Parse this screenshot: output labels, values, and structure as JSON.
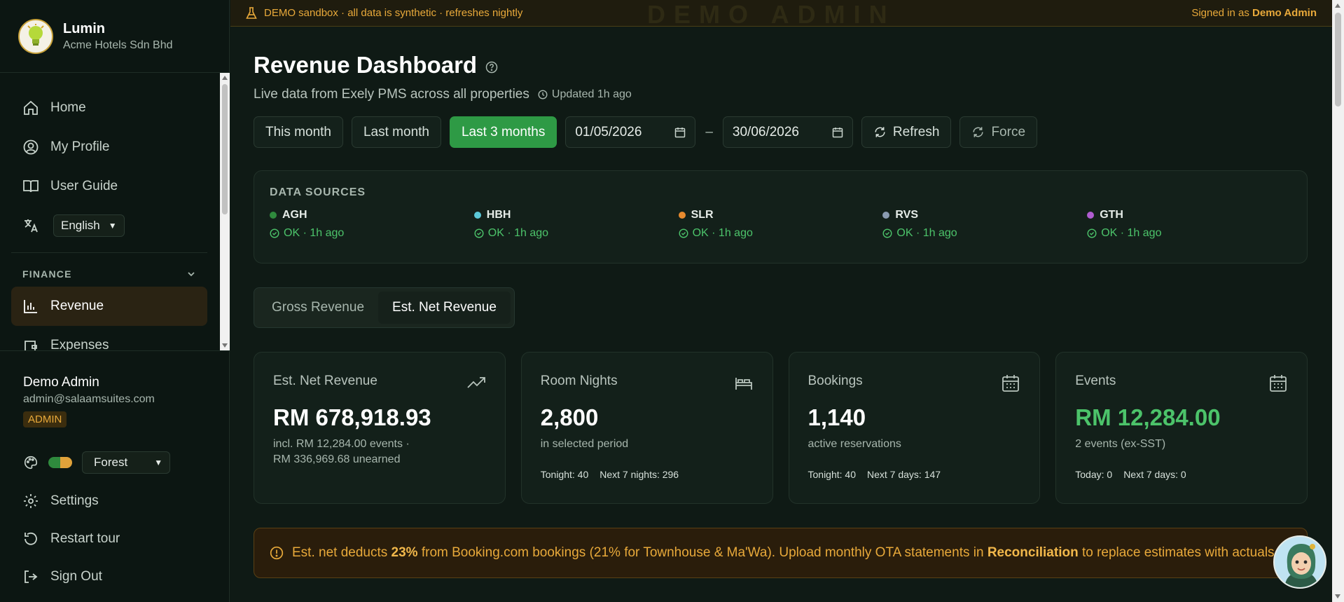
{
  "brand": {
    "name": "Lumin",
    "company": "Acme Hotels Sdn Bhd"
  },
  "sidebar": {
    "items": [
      {
        "label": "Home",
        "icon": "home-icon"
      },
      {
        "label": "My Profile",
        "icon": "user-circle-icon"
      },
      {
        "label": "User Guide",
        "icon": "book-icon"
      }
    ],
    "language": "English",
    "section": "FINANCE",
    "finance_items": [
      {
        "label": "Revenue",
        "icon": "bar-chart-icon"
      },
      {
        "label": "Expenses",
        "icon": "wallet-icon"
      }
    ]
  },
  "user": {
    "name": "Demo Admin",
    "email": "admin@salaamsuites.com",
    "role": "ADMIN"
  },
  "theme": {
    "selected": "Forest"
  },
  "bottom_nav": {
    "settings": "Settings",
    "restart_tour": "Restart tour",
    "sign_out": "Sign Out"
  },
  "banner": {
    "text": "DEMO sandbox · all data is synthetic · refreshes nightly",
    "watermark": "DEMO ADMIN",
    "signed_in_prefix": "Signed in as",
    "signed_in_user": "Demo Admin"
  },
  "page": {
    "title": "Revenue Dashboard",
    "subtitle": "Live data from Exely PMS across all properties",
    "updated": "Updated 1h ago"
  },
  "filters": {
    "this_month": "This month",
    "last_month": "Last month",
    "last_3_months": "Last 3 months",
    "date_from": "01/05/2026",
    "date_sep": "–",
    "date_to": "30/06/2026",
    "refresh": "Refresh",
    "force": "Force"
  },
  "sources": {
    "title": "DATA SOURCES",
    "items": [
      {
        "name": "AGH",
        "status": "OK · 1h ago",
        "color": "#2f8a3d"
      },
      {
        "name": "HBH",
        "status": "OK · 1h ago",
        "color": "#5bc8d8"
      },
      {
        "name": "SLR",
        "status": "OK · 1h ago",
        "color": "#e88a2e"
      },
      {
        "name": "RVS",
        "status": "OK · 1h ago",
        "color": "#8a9bb0"
      },
      {
        "name": "GTH",
        "status": "OK · 1h ago",
        "color": "#b05cd0"
      }
    ]
  },
  "tabs": {
    "gross": "Gross Revenue",
    "net": "Est. Net Revenue"
  },
  "cards": [
    {
      "label": "Est. Net Revenue",
      "value": "RM 678,918.93",
      "sub1": "incl. RM 12,284.00 events ·",
      "sub2": "RM 336,969.68 unearned",
      "meta1": "",
      "meta2": ""
    },
    {
      "label": "Room Nights",
      "value": "2,800",
      "sub1": "in selected period",
      "sub2": "",
      "meta1": "Tonight: 40",
      "meta2": "Next 7 nights: 296"
    },
    {
      "label": "Bookings",
      "value": "1,140",
      "sub1": "active reservations",
      "sub2": "",
      "meta1": "Tonight: 40",
      "meta2": "Next 7 days: 147"
    },
    {
      "label": "Events",
      "value": "RM 12,284.00",
      "sub1": "2 events (ex-SST)",
      "sub2": "",
      "meta1": "Today: 0",
      "meta2": "Next 7 days: 0"
    }
  ],
  "notice": {
    "p1": "Est. net deducts",
    "pct": "23%",
    "p2": "from Booking.com bookings (21% for Townhouse & Ma'Wa). Upload monthly OTA statements in",
    "link": "Reconciliation",
    "p3": "to replace estimates with actuals."
  },
  "colors": {
    "accent": "#2e9a45",
    "warning": "#e8a93a",
    "background": "#0f1a15"
  }
}
